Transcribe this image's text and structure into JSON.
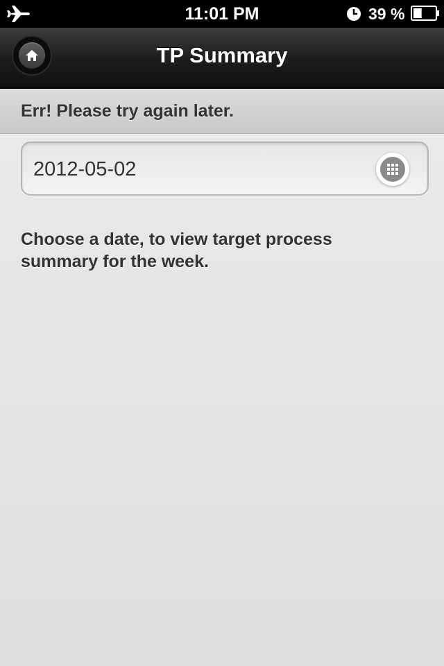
{
  "status_bar": {
    "time": "11:01 PM",
    "battery_percent": "39 %",
    "battery_level": 0.39,
    "icons": [
      "airplane-icon",
      "clock-icon",
      "battery-icon"
    ]
  },
  "header": {
    "title": "TP Summary",
    "home_icon": "home-icon"
  },
  "error": {
    "message": "Err! Please try again later."
  },
  "date_field": {
    "value": "2012-05-02",
    "button_icon": "calendar-grid-icon"
  },
  "instruction": {
    "text": "Choose a date, to view target process summary for the week."
  },
  "colors": {
    "status_bar_bg": "#000000",
    "header_bg": "#1e1e1e",
    "error_bar_bg": "#d2d2d2",
    "page_bg": "#e6e6e6",
    "text": "#333333"
  }
}
